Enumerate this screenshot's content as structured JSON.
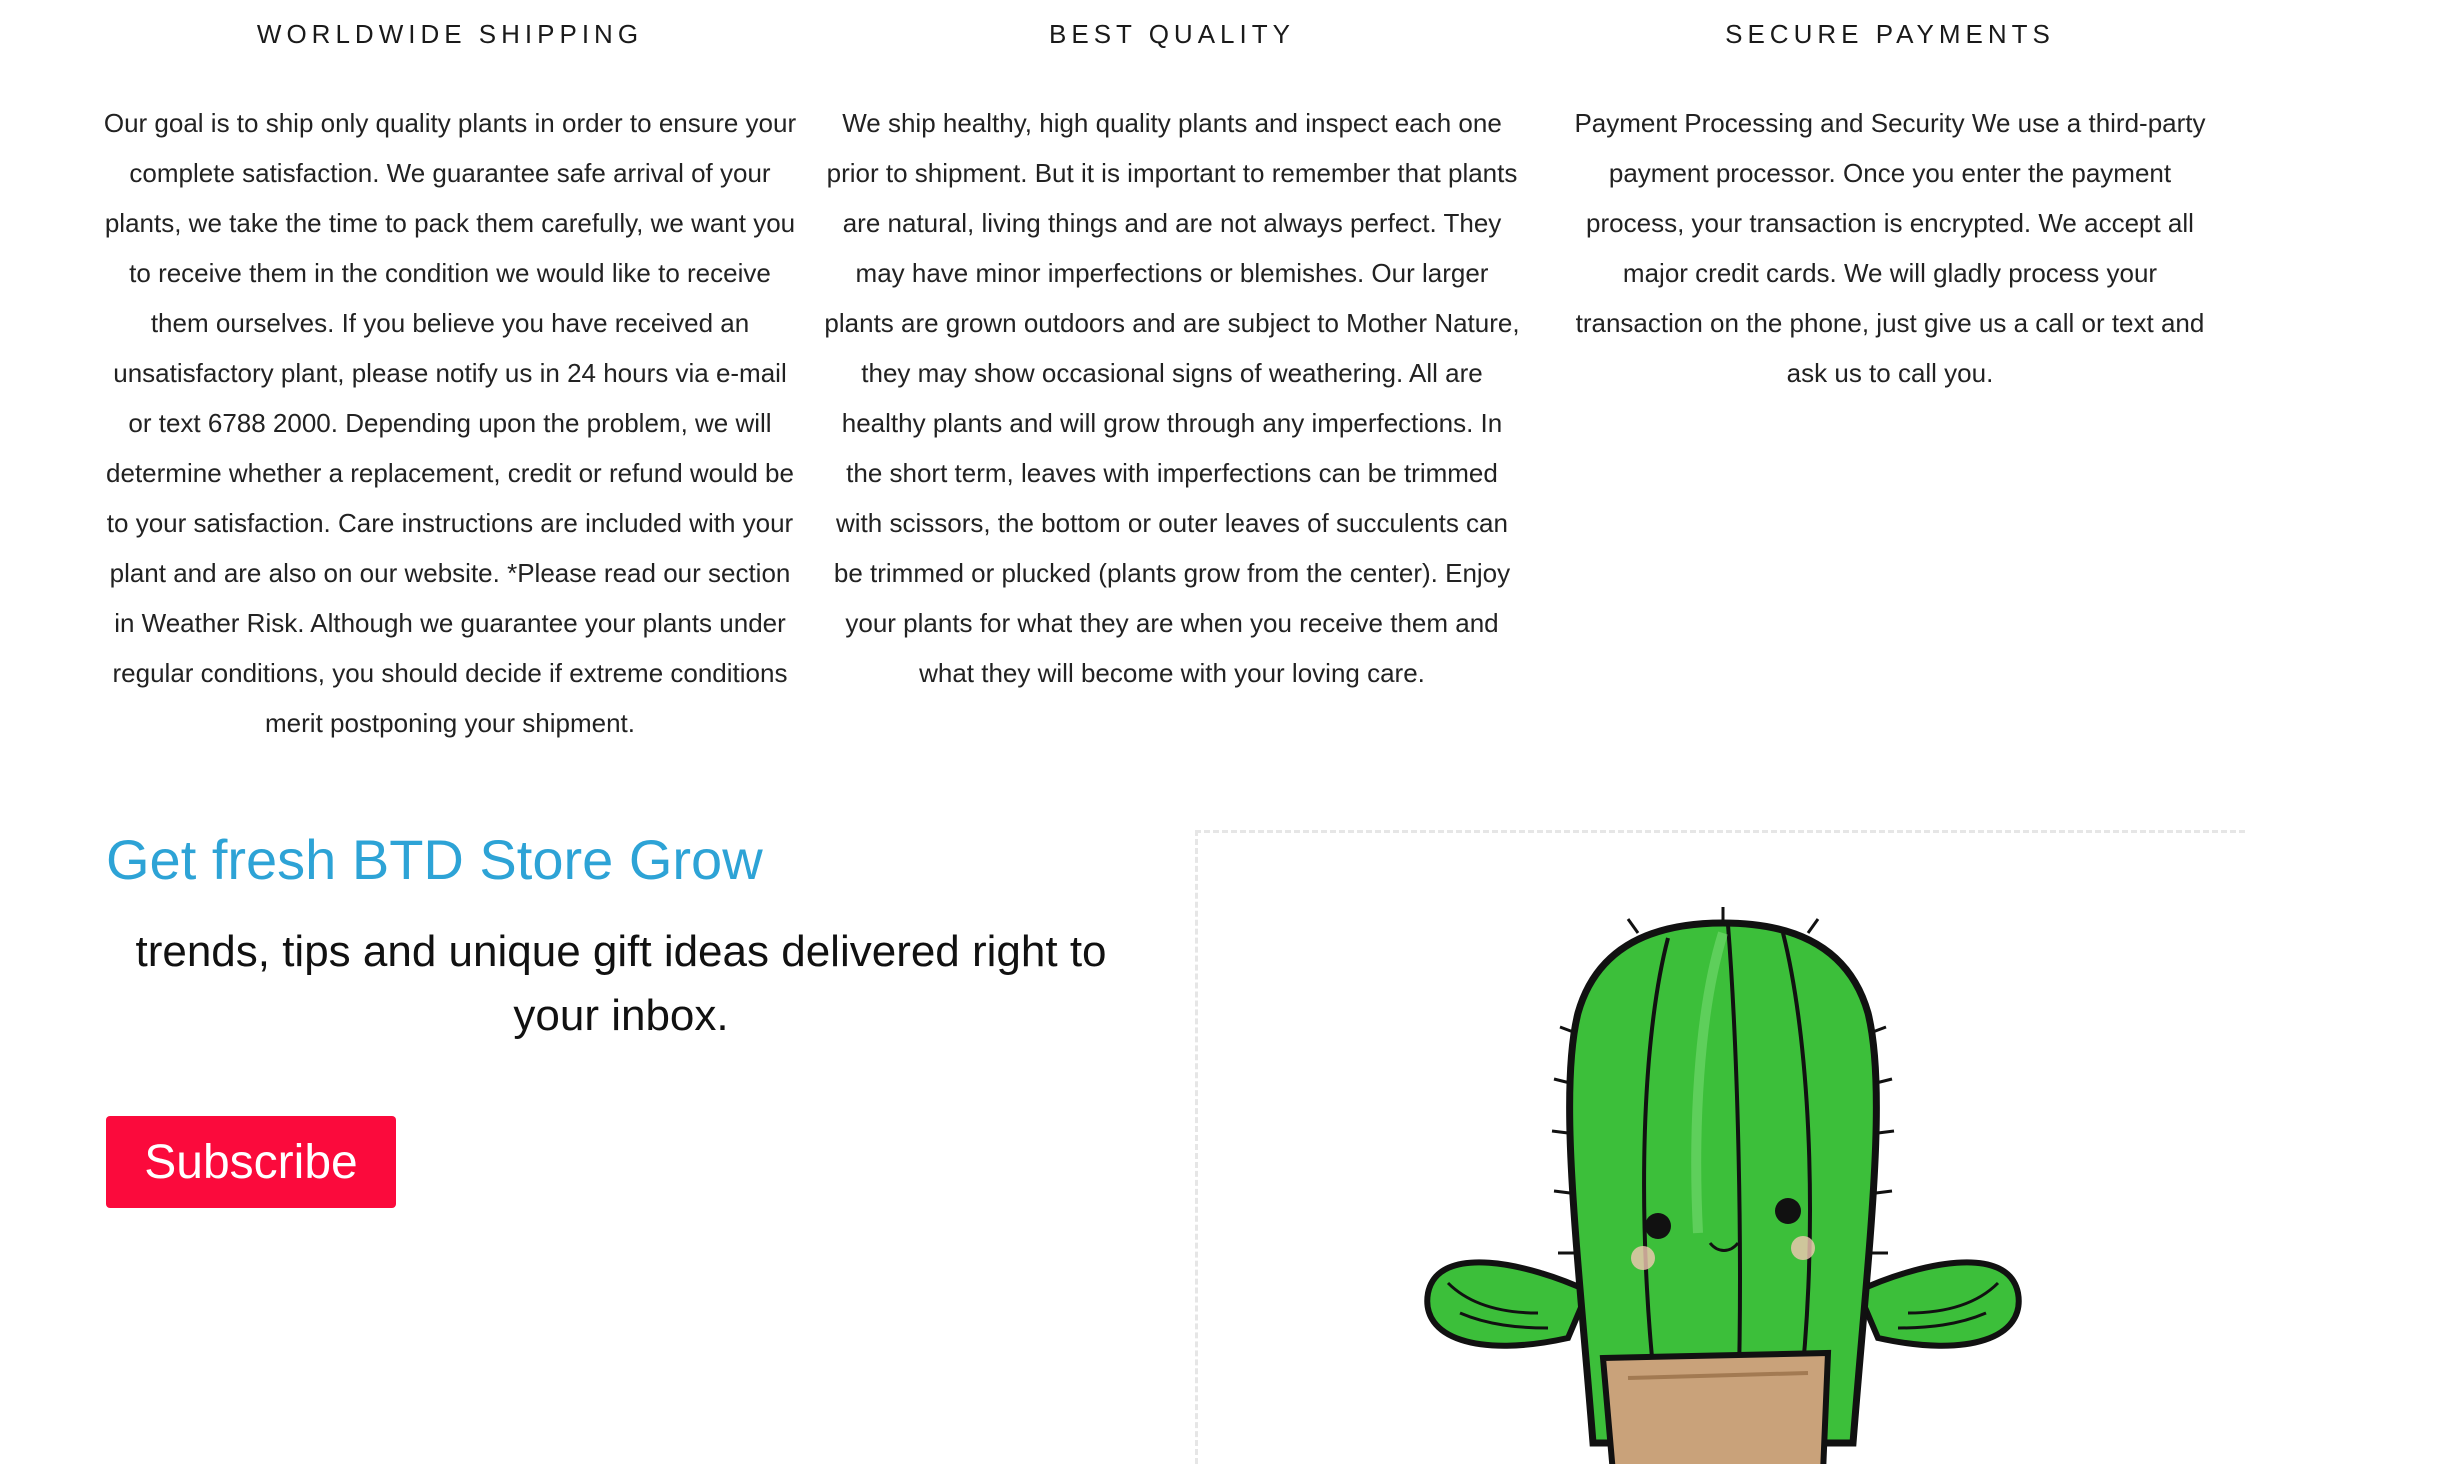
{
  "features": [
    {
      "title": "WORLDWIDE SHIPPING",
      "body": "Our goal is to ship only quality plants in order to ensure your complete satisfaction. We guarantee safe arrival of your plants, we take the time to pack them carefully, we want you to receive them in the condition we would like to receive them ourselves. If you believe you have received an unsatisfactory plant, please notify us in 24 hours via e-mail or text 6788 2000. Depending upon the problem, we will determine whether a replacement, credit or refund would be to your satisfaction. Care instructions are included with your plant and are also on our website. *Please read our section in Weather Risk. Although we guarantee your plants under regular conditions, you should decide if extreme conditions merit postponing your shipment."
    },
    {
      "title": "BEST QUALITY",
      "body": "We ship healthy, high quality plants and inspect each one prior to shipment. But it is important to remember that plants are natural, living things and are not always perfect. They may have minor imperfections or blemishes. Our larger plants are grown outdoors and are subject to Mother Nature, they may show occasional signs of weathering. All are healthy plants and will grow through any imperfections. In the short term, leaves with imperfections can be trimmed with scissors, the bottom or outer leaves of succulents can be trimmed or plucked (plants grow from the center). Enjoy your plants for what they are when you receive them and what they will become with your loving care."
    },
    {
      "title": "SECURE PAYMENTS",
      "body": "Payment Processing and Security We use a third-party payment processor. Once you enter the payment process, your transaction is encrypted. We accept all major credit cards. We will gladly process your transaction on the phone, just give us a call or text and ask us to call you."
    }
  ],
  "newsletter": {
    "heading": "Get fresh BTD Store Grow",
    "subtext": "trends, tips and unique gift ideas delivered right to your inbox.",
    "subscribe_label": "Subscribe"
  },
  "colors": {
    "heading_accent": "#2da3d6",
    "subscribe_button": "#fb0a3c",
    "cactus_green": "#3cbf3a",
    "pot_brown": "#c9a27a"
  },
  "illustration": {
    "icon": "cactus-illustration"
  }
}
